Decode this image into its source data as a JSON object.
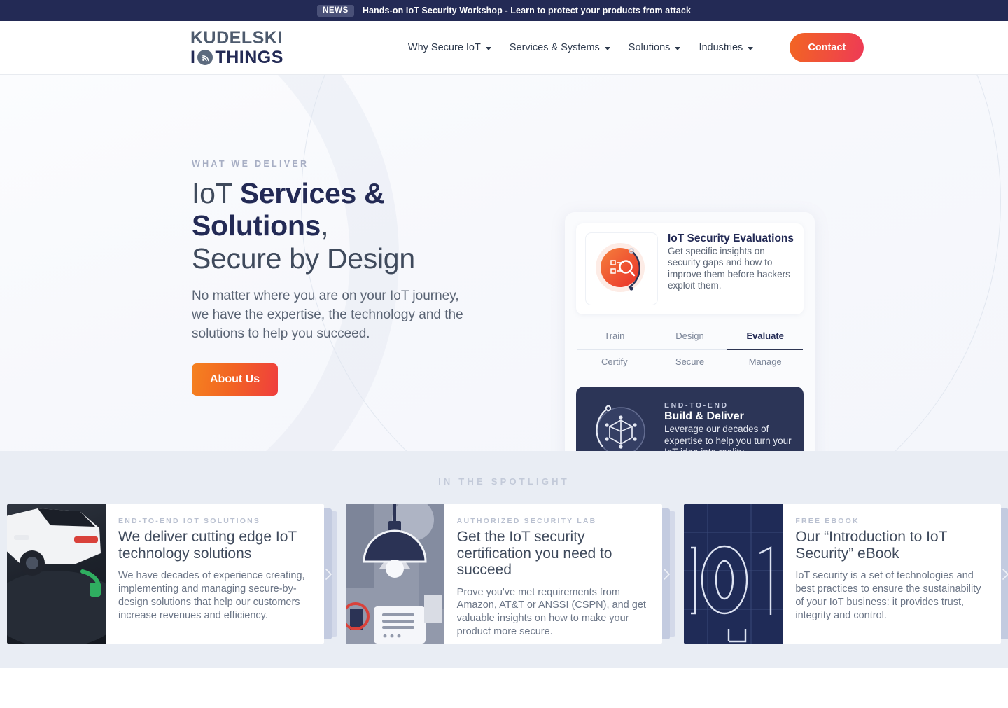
{
  "news": {
    "badge": "NEWS",
    "text": "Hands-on IoT Security Workshop - Learn to protect your products from attack"
  },
  "header": {
    "logo_line1": "KUDELSKI",
    "logo_line2_a": "I",
    "logo_line2_b": "THINGS",
    "logo_icon": "wifi-signal-icon",
    "nav": [
      {
        "label": "Why Secure IoT"
      },
      {
        "label": "Services & Systems"
      },
      {
        "label": "Solutions"
      },
      {
        "label": "Industries"
      }
    ],
    "contact_label": "Contact"
  },
  "hero": {
    "eyebrow": "WHAT WE DELIVER",
    "title_light_1": "IoT ",
    "title_bold": "Services & Solutions",
    "title_light_2": ",",
    "title_line2": "Secure by Design",
    "paragraph": "No matter where you are on your IoT journey, we have the expertise, the technology and the solutions to help you succeed.",
    "cta_label": "About Us",
    "panel": {
      "card": {
        "icon": "magnifier-checklist-icon",
        "title": "IoT Security Evaluations",
        "description": "Get specific insights on security gaps and how to improve them before hackers exploit them."
      },
      "tabs": [
        {
          "label": "Train",
          "active": false
        },
        {
          "label": "Design",
          "active": false
        },
        {
          "label": "Evaluate",
          "active": true
        },
        {
          "label": "Certify",
          "active": false
        },
        {
          "label": "Secure",
          "active": false
        },
        {
          "label": "Manage",
          "active": false
        }
      ],
      "dark_card": {
        "icon": "cube-network-icon",
        "eyebrow": "END-TO-END",
        "title": "Build & Deliver",
        "description": "Leverage our decades of expertise to help you turn your IoT idea into reality."
      }
    }
  },
  "spotlight": {
    "heading": "IN THE SPOTLIGHT",
    "cards": [
      {
        "image": "electric-car-charging-photo",
        "eyebrow": "END-TO-END IOT SOLUTIONS",
        "title": "We deliver cutting edge IoT technology solutions",
        "description": "We have decades of experience creating, implementing and managing secure-by-design solutions that help our customers increase revenues and efficiency.",
        "arrow": "chevron-right-icon"
      },
      {
        "image": "lab-lamp-illustration",
        "eyebrow": "AUTHORIZED SECURITY LAB",
        "title": "Get the IoT security certification you need to succeed",
        "description": "Prove you've met requirements from Amazon, AT&T or ANSSI (CSPN), and get valuable insights on how to make your product more secure.",
        "arrow": "chevron-right-icon"
      },
      {
        "image": "binary-101-blueprint",
        "eyebrow": "FREE EBOOK",
        "title": "Our “Introduction to IoT Security” eBook",
        "description": "IoT security is a set of technologies and best practices to ensure the sustainability of your IoT business: it provides trust, integrity and control.",
        "arrow": "chevron-right-icon"
      }
    ]
  },
  "colors": {
    "navy": "#232a55",
    "accent_orange": "#f26522",
    "accent_red": "#ee3a56",
    "spotlight_bg": "#e9edf4",
    "muted_text": "#5b6575"
  }
}
